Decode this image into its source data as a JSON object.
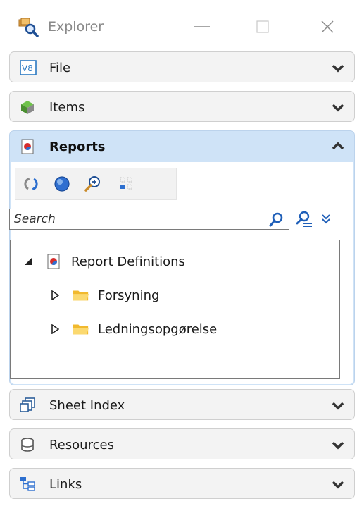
{
  "window": {
    "title": "Explorer",
    "icon": "explorer-magnifier-icon",
    "controls": [
      "minimize",
      "maximize",
      "close"
    ]
  },
  "sections": {
    "file": {
      "label": "File",
      "icon": "v8-file-icon",
      "expanded": false
    },
    "items": {
      "label": "Items",
      "icon": "items-cube-icon",
      "expanded": false
    },
    "reports": {
      "label": "Reports",
      "icon": "report-icon",
      "expanded": true
    },
    "sheet_index": {
      "label": "Sheet Index",
      "icon": "sheet-index-icon",
      "expanded": false
    },
    "resources": {
      "label": "Resources",
      "icon": "resources-db-icon",
      "expanded": false
    },
    "links": {
      "label": "Links",
      "icon": "links-tree-icon",
      "expanded": false
    }
  },
  "reports": {
    "toolbar": [
      "refresh-icon",
      "globe-icon",
      "zoom-in-icon",
      "select-grid-icon"
    ],
    "search": {
      "placeholder": "Search",
      "value": ""
    },
    "tree": [
      {
        "label": "Report Definitions",
        "icon": "report-icon",
        "toggle": "expanded",
        "level": 0
      },
      {
        "label": "Forsyning",
        "icon": "folder-icon",
        "toggle": "collapsed",
        "level": 1
      },
      {
        "label": "Ledningsopgørelse",
        "icon": "folder-icon",
        "toggle": "collapsed",
        "level": 1
      }
    ]
  },
  "colors": {
    "active_header": "#cfe3f7",
    "header": "#f3f3f3",
    "folder": "#f5c542"
  }
}
